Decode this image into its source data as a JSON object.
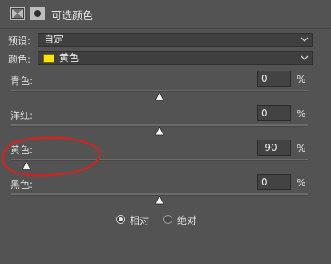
{
  "header": {
    "title": "可选颜色",
    "adjustment_icon": "selective-color-adjustment-icon",
    "mask_icon": "layer-mask-icon"
  },
  "preset": {
    "label": "预设:",
    "value": "自定"
  },
  "colors": {
    "label": "颜色:",
    "value": "黄色",
    "swatch_color": "#ffe400"
  },
  "sliders": [
    {
      "label": "青色:",
      "value": "0",
      "unit": "%",
      "fraction": 0.5
    },
    {
      "label": "洋红:",
      "value": "0",
      "unit": "%",
      "fraction": 0.5
    },
    {
      "label": "黄色:",
      "value": "-90",
      "unit": "%",
      "fraction": 0.05
    },
    {
      "label": "黑色:",
      "value": "0",
      "unit": "%",
      "fraction": 0.5
    }
  ],
  "method": {
    "relative_label": "相对",
    "absolute_label": "绝对",
    "selected": "relative"
  },
  "annotation_color": "#d0231f"
}
